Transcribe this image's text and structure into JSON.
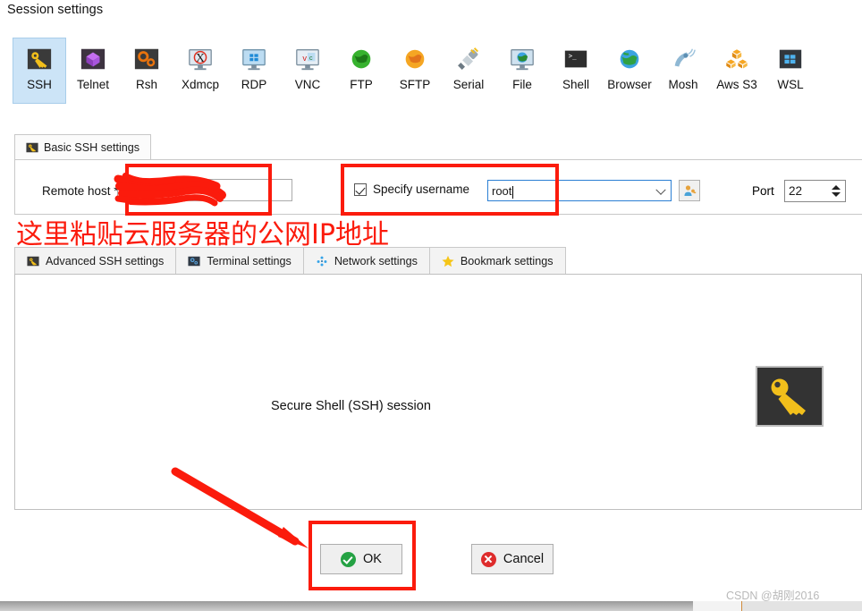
{
  "window": {
    "title": "Session settings"
  },
  "session_types": [
    {
      "label": "SSH",
      "icon": "ssh-key-icon",
      "selected": true
    },
    {
      "label": "Telnet",
      "icon": "telnet-cube-icon",
      "selected": false
    },
    {
      "label": "Rsh",
      "icon": "rsh-gears-icon",
      "selected": false
    },
    {
      "label": "Xdmcp",
      "icon": "xdmcp-monitor-icon",
      "selected": false
    },
    {
      "label": "RDP",
      "icon": "rdp-windows-monitor-icon",
      "selected": false
    },
    {
      "label": "VNC",
      "icon": "vnc-monitor-icon",
      "selected": false
    },
    {
      "label": "FTP",
      "icon": "ftp-green-globe-icon",
      "selected": false
    },
    {
      "label": "SFTP",
      "icon": "sftp-orange-globe-icon",
      "selected": false
    },
    {
      "label": "Serial",
      "icon": "serial-plug-icon",
      "selected": false
    },
    {
      "label": "File",
      "icon": "file-monitor-globe-icon",
      "selected": false
    },
    {
      "label": "Shell",
      "icon": "shell-terminal-icon",
      "selected": false
    },
    {
      "label": "Browser",
      "icon": "browser-globe-icon",
      "selected": false
    },
    {
      "label": "Mosh",
      "icon": "mosh-satellite-icon",
      "selected": false
    },
    {
      "label": "Aws S3",
      "icon": "aws-s3-cubes-icon",
      "selected": false
    },
    {
      "label": "WSL",
      "icon": "wsl-windows-icon",
      "selected": false
    }
  ],
  "top_tab": {
    "label": "Basic SSH settings",
    "icon": "ssh-key-icon"
  },
  "form": {
    "remote_host_label": "Remote host *",
    "remote_host_value": "",
    "specify_username_label": "Specify username",
    "specify_username_checked": true,
    "username_value": "root",
    "username_dropdown_icon": "chevron-down-icon",
    "user_picker_icon": "user-key-icon",
    "port_label": "Port",
    "port_value": "22",
    "port_spinner_icon": "spinner-up-down-icon"
  },
  "bottom_tabs": [
    {
      "label": "Advanced SSH settings",
      "icon": "ssh-key-icon"
    },
    {
      "label": "Terminal settings",
      "icon": "terminal-blue-icon"
    },
    {
      "label": "Network settings",
      "icon": "network-nodes-icon"
    },
    {
      "label": "Bookmark settings",
      "icon": "star-icon"
    }
  ],
  "panel": {
    "caption": "Secure Shell (SSH) session",
    "icon": "ssh-key-large-icon"
  },
  "footer": {
    "ok_label": "OK",
    "ok_icon": "green-check-icon",
    "cancel_label": "Cancel",
    "cancel_icon": "red-x-icon"
  },
  "annotations": {
    "note_cn": "这里粘贴云服务器的公网IP地址",
    "note_color": "#fb1b0c",
    "highlight_color": "#fb1b0c",
    "arrow_icon": "red-arrow-icon",
    "scribble_icon": "red-scribble-icon"
  },
  "watermark": {
    "text": "CSDN @胡刚2016"
  }
}
